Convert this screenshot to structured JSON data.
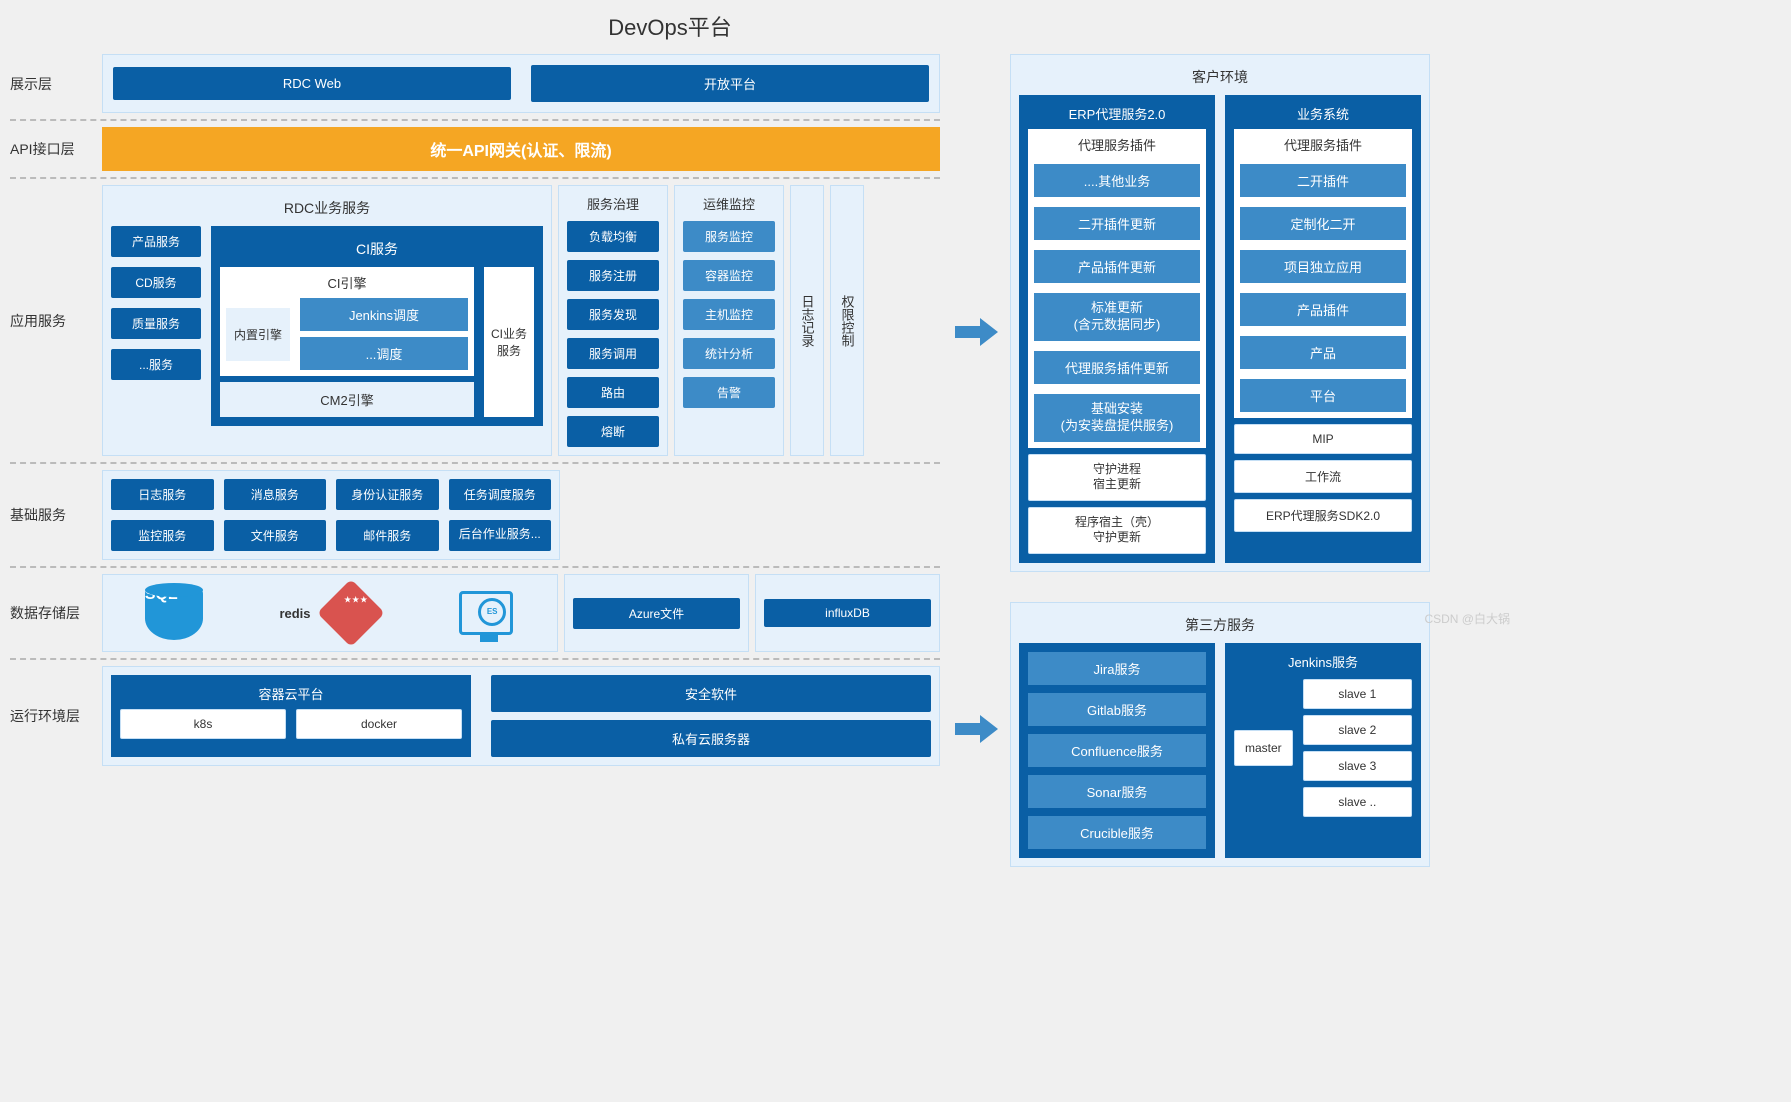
{
  "title": "DevOps平台",
  "leftLayers": {
    "presentation": {
      "label": "展示层",
      "items": [
        "RDC Web",
        "开放平台"
      ]
    },
    "api": {
      "label": "API接口层",
      "gateway": "统一API网关(认证、限流)"
    },
    "app": {
      "label": "应用服务",
      "sideButtons": [
        "产品服务",
        "CD服务",
        "质量服务",
        "...服务"
      ],
      "rdc": {
        "title": "RDC业务服务",
        "ci": {
          "title": "CI服务",
          "engineTitle": "CI引擎",
          "builtin": {
            "label": "内置引擎",
            "items": [
              "Jenkins调度",
              "...调度"
            ]
          },
          "cm2": "CM2引擎",
          "ciBiz": "CI业务\n服务"
        }
      },
      "governance": {
        "title": "服务治理",
        "items": [
          "负载均衡",
          "服务注册",
          "服务发现",
          "服务调用",
          "路由",
          "熔断"
        ]
      },
      "ops": {
        "title": "运维监控",
        "items": [
          "服务监控",
          "容器监控",
          "主机监控",
          "统计分析",
          "告警"
        ]
      },
      "logBar": "日志记录",
      "authBar": "权限控制"
    },
    "base": {
      "label": "基础服务",
      "items": [
        "日志服务",
        "消息服务",
        "身份认证服务",
        "任务调度服务",
        "监控服务",
        "文件服务",
        "邮件服务",
        "后台作业服务..."
      ]
    },
    "storage": {
      "label": "数据存储层",
      "sql": "SQL",
      "redis": "redis",
      "items": [
        "Azure文件",
        "influxDB"
      ]
    },
    "runtime": {
      "label": "运行环境层",
      "container": {
        "title": "容器云平台",
        "items": [
          "k8s",
          "docker"
        ]
      },
      "right": [
        "安全软件",
        "私有云服务器"
      ]
    }
  },
  "rightTop": {
    "title": "客户环境",
    "erp": {
      "title": "ERP代理服务2.0",
      "pluginTitle": "代理服务插件",
      "plugins": [
        "....其他业务",
        "二开插件更新",
        "产品插件更新",
        "标准更新\n(含元数据同步)",
        "代理服务插件更新",
        "基础安装\n(为安装盘提供服务)"
      ],
      "extras": [
        "守护进程\n宿主更新",
        "程序宿主（壳）\n守护更新"
      ]
    },
    "biz": {
      "title": "业务系统",
      "pluginTitle": "代理服务插件",
      "plugins": [
        "二开插件",
        "定制化二开",
        "项目独立应用",
        "产品插件",
        "产品",
        "平台"
      ],
      "extras": [
        "MIP",
        "工作流",
        "ERP代理服务SDK2.0"
      ]
    }
  },
  "rightBottom": {
    "title": "第三方服务",
    "left": [
      "Jira服务",
      "Gitlab服务",
      "Confluence服务",
      "Sonar服务",
      "Crucible服务"
    ],
    "jenkins": {
      "title": "Jenkins服务",
      "master": "master",
      "slaves": [
        "slave 1",
        "slave 2",
        "slave 3",
        "slave .."
      ]
    }
  },
  "watermark": "CSDN @白大锅"
}
